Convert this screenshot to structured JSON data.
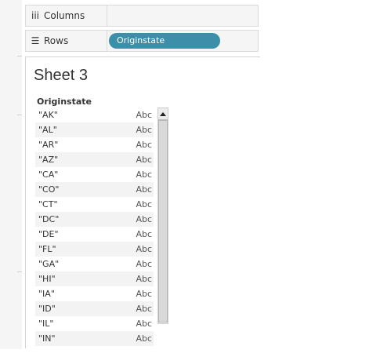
{
  "shelves": {
    "columns": {
      "label": "Columns",
      "icon": "columns-icon",
      "glyph": "iii"
    },
    "rows": {
      "label": "Rows",
      "icon": "rows-icon",
      "glyph": "☰",
      "pill": "Originstate"
    }
  },
  "colors": {
    "pill": "#3d8ea8",
    "alt_row": "#f3f3f3"
  },
  "sheet": {
    "title": "Sheet 3",
    "column_header": "Originstate",
    "rows": [
      {
        "state": "\"AK\"",
        "value": "Abc"
      },
      {
        "state": "\"AL\"",
        "value": "Abc"
      },
      {
        "state": "\"AR\"",
        "value": "Abc"
      },
      {
        "state": "\"AZ\"",
        "value": "Abc"
      },
      {
        "state": "\"CA\"",
        "value": "Abc"
      },
      {
        "state": "\"CO\"",
        "value": "Abc"
      },
      {
        "state": "\"CT\"",
        "value": "Abc"
      },
      {
        "state": "\"DC\"",
        "value": "Abc"
      },
      {
        "state": "\"DE\"",
        "value": "Abc"
      },
      {
        "state": "\"FL\"",
        "value": "Abc"
      },
      {
        "state": "\"GA\"",
        "value": "Abc"
      },
      {
        "state": "\"HI\"",
        "value": "Abc"
      },
      {
        "state": "\"IA\"",
        "value": "Abc"
      },
      {
        "state": "\"ID\"",
        "value": "Abc"
      },
      {
        "state": "\"IL\"",
        "value": "Abc"
      },
      {
        "state": "\"IN\"",
        "value": "Abc"
      }
    ]
  }
}
